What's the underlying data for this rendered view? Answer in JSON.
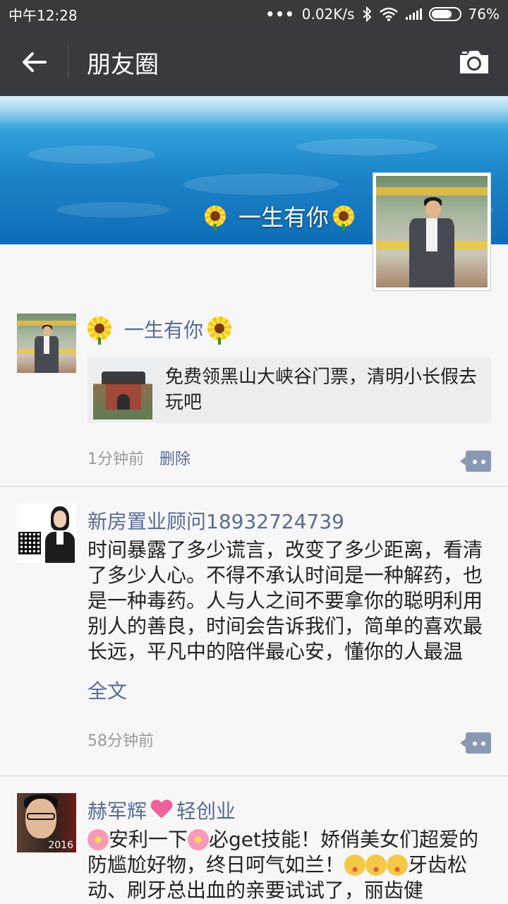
{
  "status_bar": {
    "time": "中午12:28",
    "dots": "•••",
    "speed": "0.02K/s",
    "battery": "76%",
    "battery_level": 0.76,
    "icons": [
      "bluetooth-icon",
      "wifi-icon",
      "signal-icon",
      "battery-icon"
    ]
  },
  "app_bar": {
    "title": "朋友圈",
    "back_icon": "arrow-left-icon",
    "camera_icon": "camera-icon"
  },
  "cover": {
    "name": "一生有你"
  },
  "posts": [
    {
      "nickname": "一生有你",
      "link_title": "免费领黑山大峡谷门票，清明小长假去玩吧",
      "time": "1分钟前",
      "delete_label": "删除"
    },
    {
      "nickname": "新房置业顾问18932724739",
      "text": "时间暴露了多少谎言，改变了多少距离，看清了多少人心。不得不承认时间是一种解药，也是一种毒药。人与人之间不要拿你的聪明利用别人的善良，时间会告诉我们，简单的喜欢最长远，平凡中的陪伴最心安，懂你的人最温暖。“有一天你会明白，善良比",
      "more_label": "全文",
      "time": "58分钟前"
    },
    {
      "nickname_a": "赫军辉",
      "nickname_b": "轻创业",
      "text_1": "安利一下",
      "text_2": "必get技能！娇俏美女们超爱的防尴尬好物，终日呵气如兰！",
      "text_3": "牙齿松动、刷牙总出血的亲要试试了，丽齿健",
      "avatar_year": "2016"
    }
  ],
  "colors": {
    "nickname": "#576b95",
    "app_bar": "#393a3f",
    "status_bar": "#383a3c",
    "background": "#f7f7f7"
  }
}
